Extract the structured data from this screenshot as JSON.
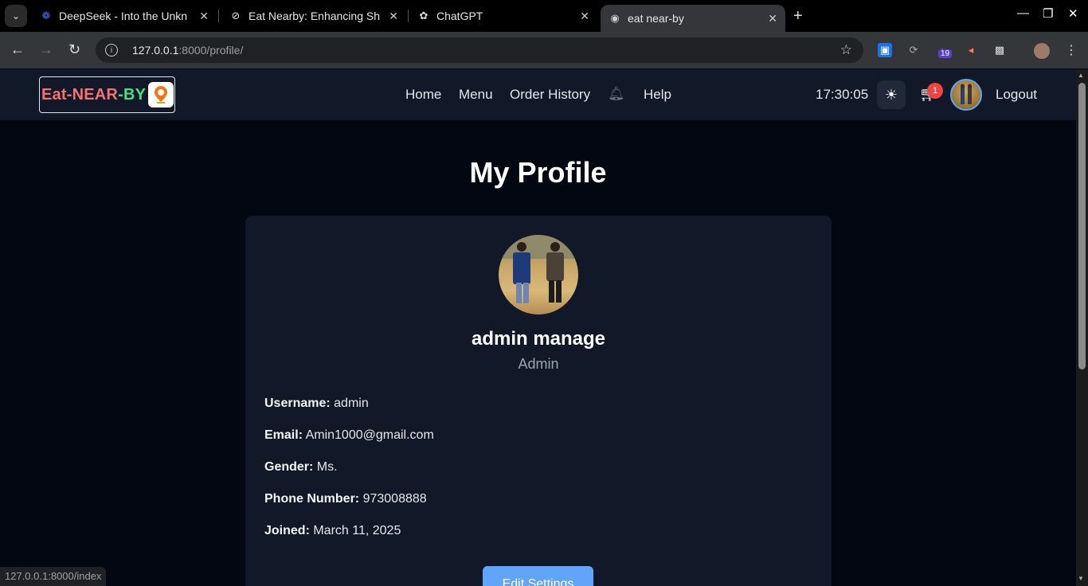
{
  "browser": {
    "tabs": [
      {
        "title": "DeepSeek - Into the Unkn",
        "icon": "deepseek-icon"
      },
      {
        "title": "Eat Nearby: Enhancing Sh",
        "icon": "perplexity-icon"
      },
      {
        "title": "ChatGPT",
        "icon": "openai-icon"
      },
      {
        "title": "eat near-by",
        "icon": "globe-icon",
        "active": true
      }
    ],
    "url_host": "127.0.0.1",
    "url_path": ":8000/profile/",
    "extension_badge": "19",
    "status_url": "127.0.0.1:8000/index"
  },
  "site": {
    "logo": {
      "part1": "Eat",
      "dash1": "-",
      "part2": "NEAR",
      "dash2": "-",
      "part3": "BY"
    },
    "nav": {
      "home": "Home",
      "menu": "Menu",
      "order_history": "Order History",
      "help": "Help"
    },
    "clock": "17:30:05",
    "cart_count": "1",
    "logout": "Logout"
  },
  "profile": {
    "title": "My Profile",
    "full_name": "admin manage",
    "role": "Admin",
    "fields": [
      {
        "label": "Username:",
        "value": "admin"
      },
      {
        "label": "Email:",
        "value": "Amin1000@gmail.com"
      },
      {
        "label": "Gender:",
        "value": "Ms."
      },
      {
        "label": "Phone Number:",
        "value": "973008888"
      },
      {
        "label": "Joined:",
        "value": "March 11, 2025"
      }
    ],
    "edit_button": "Edit Settings"
  },
  "colors": {
    "page_bg": "#030712",
    "nav_bg": "#111827",
    "card_bg": "#111827",
    "accent": "#60a5fa",
    "badge": "#ef4444",
    "logo_red": "#f87171",
    "logo_green": "#4ade80"
  }
}
